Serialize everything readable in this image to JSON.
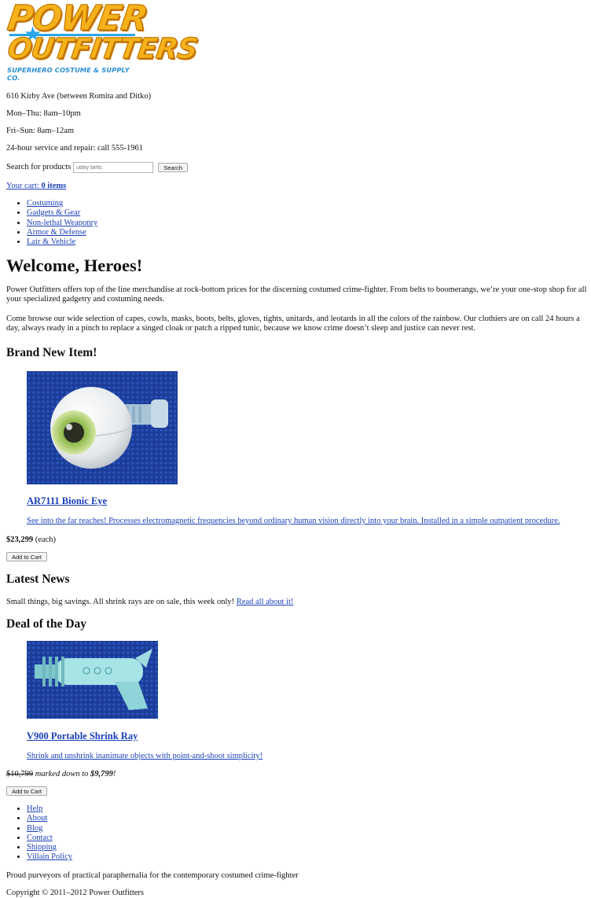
{
  "logo": {
    "line1": "POWER",
    "line2": "OUTFITTERS",
    "tagline": "SUPERHERO COSTUME & SUPPLY CO."
  },
  "info": {
    "address": "616 Kirby Ave (between Romita and Ditko)",
    "hours_weekday": "Mon–Thu: 8am–10pm",
    "hours_weekend": "Fri–Sun: 8am–12am",
    "service": "24-hour service and repair: call 555-1961"
  },
  "search": {
    "label": "Search for products",
    "placeholder": "utility belts",
    "button": "Search"
  },
  "cart": {
    "label": "Your cart:",
    "count": "0 items"
  },
  "nav": [
    "Costuming",
    "Gadgets & Gear",
    "Non-lethal Weaponry",
    "Armor & Defense",
    "Lair & Vehicle"
  ],
  "welcome": {
    "heading": "Welcome, Heroes!",
    "p1": "Power Outfitters offers top of the line merchandise at rock-bottom prices for the discerning costumed crime-fighter. From belts to boomerangs, we’re your one-stop shop for all your specialized gadgetry and costuming needs.",
    "p2": "Come browse our wide selection of capes, cowls, masks, boots, belts, gloves, tights, unitards, and leotards in all the colors of the rainbow. Our clothiers are on call 24 hours a day, always ready in a pinch to replace a singed cloak or patch a ripped tunic, because we know crime doesn’t sleep and justice can never rest."
  },
  "new_item": {
    "heading": "Brand New Item!",
    "title": "AR7111 Bionic Eye",
    "description": "See into the far reaches! Processes electromagnetic frequencies beyond ordinary human vision directly into your brain. Installed in a simple outpatient procedure.",
    "price": "$23,299",
    "unit": "(each)",
    "button": "Add to Cart"
  },
  "news": {
    "heading": "Latest News",
    "text": "Small things, big savings. All shrink rays are on sale, this week only!",
    "link": "Read all about it!"
  },
  "deal": {
    "heading": "Deal of the Day",
    "title": "V900 Portable Shrink Ray",
    "description": "Shrink and unshrink inanimate objects with point-and-shoot simplicity!",
    "old_price": "$10,799",
    "markdown_text": "marked down to",
    "new_price": "$9,799",
    "exclaim": "!",
    "button": "Add to Cart"
  },
  "footer": {
    "links": [
      "Help",
      "About",
      "Blog",
      "Contact",
      "Shipping",
      "Villain Policy"
    ],
    "tagline": "Proud purveyors of practical paraphernalia for the contemporary costumed crime-fighter",
    "copyright": "Copyright © 2011–2012 Power Outfitters"
  },
  "colors": {
    "link": "#1a3fb8",
    "logo_yellow": "#f6b21a",
    "logo_blue": "#2aa6e8",
    "product_bg": "#1f3f9a"
  }
}
